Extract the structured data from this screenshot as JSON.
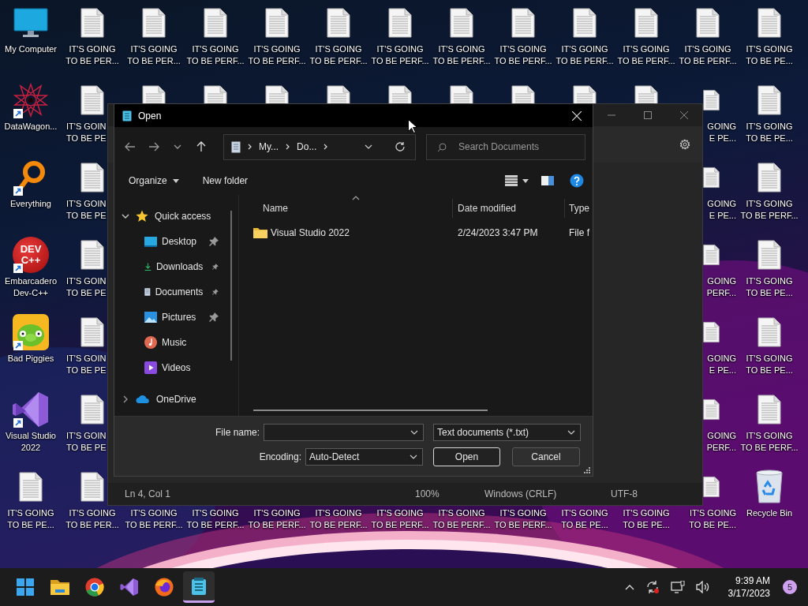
{
  "desktop": {
    "columns": [
      [
        {
          "kind": "computer",
          "shortcut": false,
          "lines": [
            "My Computer"
          ]
        },
        {
          "kind": "starburst",
          "shortcut": true,
          "lines": [
            "DataWagon..."
          ]
        },
        {
          "kind": "magnifier",
          "shortcut": true,
          "lines": [
            "Everything"
          ]
        },
        {
          "kind": "devcpp",
          "shortcut": true,
          "logo_lines": [
            "DEV",
            "C++"
          ],
          "lines": [
            "Embarcadero",
            "Dev-C++"
          ]
        },
        {
          "kind": "pig",
          "shortcut": true,
          "lines": [
            "Bad Piggies"
          ]
        },
        {
          "kind": "ribbon",
          "shortcut": true,
          "lines": [
            "Visual Studio",
            "2022"
          ]
        },
        {
          "kind": "document",
          "lines": [
            "IT'S GOING",
            "TO BE PE..."
          ]
        }
      ],
      [
        {
          "kind": "document",
          "lines": [
            "IT'S GOING",
            "TO BE PER..."
          ]
        },
        {
          "kind": "document",
          "lines": [
            "IT'S GOIN",
            "TO BE PE"
          ]
        },
        {
          "kind": "document",
          "lines": [
            "IT'S GOIN",
            "TO BE PE"
          ]
        },
        {
          "kind": "document",
          "lines": [
            "IT'S GOIN",
            "TO BE PE"
          ]
        },
        {
          "kind": "document",
          "lines": [
            "IT'S GOIN",
            "TO BE PE"
          ]
        },
        {
          "kind": "document",
          "lines": [
            "IT'S GOIN",
            "TO BE PE"
          ]
        },
        {
          "kind": "document",
          "lines": [
            "IT'S GOING",
            "TO BE PER..."
          ]
        }
      ],
      [
        {
          "kind": "document",
          "lines": [
            "IT'S GOING",
            "TO BE PER..."
          ]
        },
        {
          "kind": "document"
        },
        null,
        null,
        null,
        null,
        {
          "kind": "label",
          "lines": [
            "IT'S GOING",
            "TO BE PERF..."
          ]
        }
      ],
      [
        {
          "kind": "document",
          "lines": [
            "IT'S GOING",
            "TO BE PERF..."
          ]
        },
        {
          "kind": "document"
        },
        null,
        null,
        null,
        null,
        {
          "kind": "label",
          "lines": [
            "IT'S GOING",
            "TO BE PERF..."
          ]
        }
      ],
      [
        {
          "kind": "document",
          "lines": [
            "IT'S GOING",
            "TO BE PERF..."
          ]
        },
        {
          "kind": "document"
        },
        null,
        null,
        null,
        null,
        {
          "kind": "label",
          "lines": [
            "IT'S GOING",
            "TO BE PERF..."
          ]
        }
      ],
      [
        {
          "kind": "document",
          "lines": [
            "IT'S GOING",
            "TO BE PERF..."
          ]
        },
        {
          "kind": "document"
        },
        null,
        null,
        null,
        null,
        {
          "kind": "label",
          "lines": [
            "IT'S GOING",
            "TO BE PERF..."
          ]
        }
      ],
      [
        {
          "kind": "document",
          "lines": [
            "IT'S GOING",
            "TO BE PERF..."
          ]
        },
        {
          "kind": "document"
        },
        null,
        null,
        null,
        null,
        {
          "kind": "label",
          "lines": [
            "IT'S GOING",
            "TO BE PERF..."
          ]
        }
      ],
      [
        {
          "kind": "document",
          "lines": [
            "IT'S GOING",
            "TO BE PERF..."
          ]
        },
        {
          "kind": "document"
        },
        null,
        null,
        null,
        null,
        {
          "kind": "label",
          "lines": [
            "IT'S GOING",
            "TO BE PERF..."
          ]
        }
      ],
      [
        {
          "kind": "document",
          "lines": [
            "IT'S GOING",
            "TO BE PERF..."
          ]
        },
        {
          "kind": "document"
        },
        null,
        null,
        null,
        null,
        {
          "kind": "label",
          "lines": [
            "IT'S GOING",
            "TO BE PERF..."
          ]
        }
      ],
      [
        {
          "kind": "document",
          "lines": [
            "IT'S GOING",
            "TO BE PERF..."
          ]
        },
        {
          "kind": "document"
        },
        null,
        null,
        null,
        null,
        {
          "kind": "label",
          "lines": [
            "IT'S GOING",
            "TO BE PE..."
          ]
        }
      ],
      [
        {
          "kind": "document",
          "lines": [
            "IT'S GOING",
            "TO BE PERF..."
          ]
        },
        {
          "kind": "document"
        },
        null,
        null,
        null,
        null,
        {
          "kind": "label",
          "lines": [
            "IT'S GOING",
            "TO BE PE..."
          ]
        }
      ],
      [
        {
          "kind": "document",
          "lines": [
            "IT'S GOING",
            "TO BE PERF..."
          ]
        },
        {
          "kind": "document",
          "lines": [
            "GOING",
            "E PE..."
          ]
        },
        {
          "kind": "document",
          "lines": [
            "GOING",
            "E PE..."
          ]
        },
        {
          "kind": "document",
          "lines": [
            "GOING",
            "PERF..."
          ]
        },
        {
          "kind": "document",
          "lines": [
            "GOING",
            "E PE..."
          ]
        },
        {
          "kind": "document",
          "lines": [
            "GOING",
            "PERF..."
          ]
        },
        {
          "kind": "document",
          "lines": [
            "IT'S GOING",
            "TO BE PE..."
          ]
        }
      ],
      [
        {
          "kind": "document",
          "lines": [
            "IT'S GOING",
            "TO BE PE..."
          ]
        },
        {
          "kind": "document",
          "lines": [
            "IT'S GOING",
            "TO BE PE..."
          ]
        },
        {
          "kind": "document",
          "lines": [
            "IT'S GOING",
            "TO BE PERF..."
          ]
        },
        {
          "kind": "document",
          "lines": [
            "IT'S GOING",
            "TO BE PE..."
          ]
        },
        {
          "kind": "document",
          "lines": [
            "IT'S GOING",
            "TO BE PE..."
          ]
        },
        {
          "kind": "document",
          "lines": [
            "IT'S GOING",
            "TO BE PERF..."
          ]
        },
        {
          "kind": "recycle",
          "shortcut": false,
          "lines": [
            "Recycle Bin"
          ]
        }
      ]
    ]
  },
  "notepad_window": {
    "status_bar": [
      "Ln 4, Col 1",
      "100%",
      "Windows (CRLF)",
      "UTF-8"
    ]
  },
  "open_dialog": {
    "title": "Open",
    "address": [
      "My...",
      "Do..."
    ],
    "search": {
      "placeholder": "Search Documents"
    },
    "commands": [
      "Organize",
      "New folder"
    ],
    "nav": [
      {
        "label": "Quick access",
        "kind": "star",
        "expanded": true,
        "children": [
          {
            "label": "Desktop",
            "kind": "desktop",
            "pinned": true
          },
          {
            "label": "Downloads",
            "kind": "download",
            "pinned": true
          },
          {
            "label": "Documents",
            "kind": "document",
            "pinned": true
          },
          {
            "label": "Pictures",
            "kind": "picture",
            "pinned": true
          },
          {
            "label": "Music",
            "kind": "music",
            "pinned": false
          },
          {
            "label": "Videos",
            "kind": "video",
            "pinned": false
          }
        ]
      },
      {
        "label": "OneDrive",
        "kind": "cloud",
        "expanded": false
      }
    ],
    "columns": [
      "Name",
      "Date modified",
      "Type"
    ],
    "rows": [
      {
        "name": "Visual Studio 2022",
        "date": "2/24/2023 3:47 PM",
        "type": "File f"
      }
    ],
    "file_name": {
      "label": "File name:"
    },
    "file_type": "Text documents (*.txt)",
    "encoding": {
      "label": "Encoding:",
      "value": "Auto-Detect"
    },
    "buttons": [
      {
        "label": "Open",
        "default": true
      },
      {
        "label": "Cancel",
        "default": false
      }
    ]
  },
  "taskbar": {
    "apps": [
      {
        "kind": "start",
        "active": false
      },
      {
        "kind": "folder",
        "active": false
      },
      {
        "kind": "chrome",
        "active": false
      },
      {
        "kind": "ribbon",
        "active": false
      },
      {
        "kind": "firefox",
        "active": false
      },
      {
        "kind": "notepad",
        "active": true
      }
    ],
    "time": "9:39 AM",
    "date": "3/17/2023",
    "notifications": "5"
  }
}
